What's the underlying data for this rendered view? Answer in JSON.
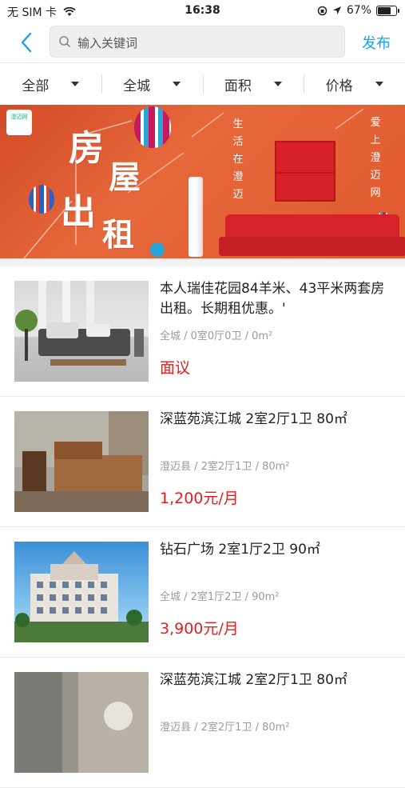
{
  "status": {
    "carrier": "无 SIM 卡",
    "time": "16:38",
    "battery": "67%",
    "battery_level": 0.67
  },
  "nav": {
    "search_placeholder": "输入关键词",
    "publish_label": "发布"
  },
  "filters": [
    {
      "label": "全部"
    },
    {
      "label": "全城"
    },
    {
      "label": "面积"
    },
    {
      "label": "价格"
    }
  ],
  "banner": {
    "logo_text": "澄迈网",
    "title_chars": [
      "房",
      "屋",
      "出",
      "租"
    ],
    "slogan_left": [
      "生",
      "活",
      "在",
      "澄",
      "迈"
    ],
    "slogan_right": [
      "爱",
      "上",
      "澄",
      "迈",
      "网"
    ],
    "colors": {
      "background": "#e0602f",
      "sofa": "#d8222a"
    }
  },
  "listings": [
    {
      "title": "本人瑞佳花园84羊米、43平米两套房出租。长期租优惠。'",
      "meta": "全城 / 0室0厅0卫 / 0m²",
      "price": "面议",
      "thumb": "living-room"
    },
    {
      "title": "深蓝苑滨江城 2室2厅1卫 80㎡",
      "meta": "澄迈县 / 2室2厅1卫 / 80m²",
      "price": "1,200元/月",
      "thumb": "bedroom"
    },
    {
      "title": "钻石广场 2室1厅2卫 90㎡",
      "meta": "全城 / 2室1厅2卫 / 90m²",
      "price": "3,900元/月",
      "thumb": "building"
    },
    {
      "title": "深蓝苑滨江城 2室2厅1卫 80㎡",
      "meta": "澄迈县 / 2室2厅1卫 / 80m²",
      "price": "",
      "thumb": "room"
    }
  ],
  "accent_color": "#1aa0e8",
  "price_color": "#e02020"
}
